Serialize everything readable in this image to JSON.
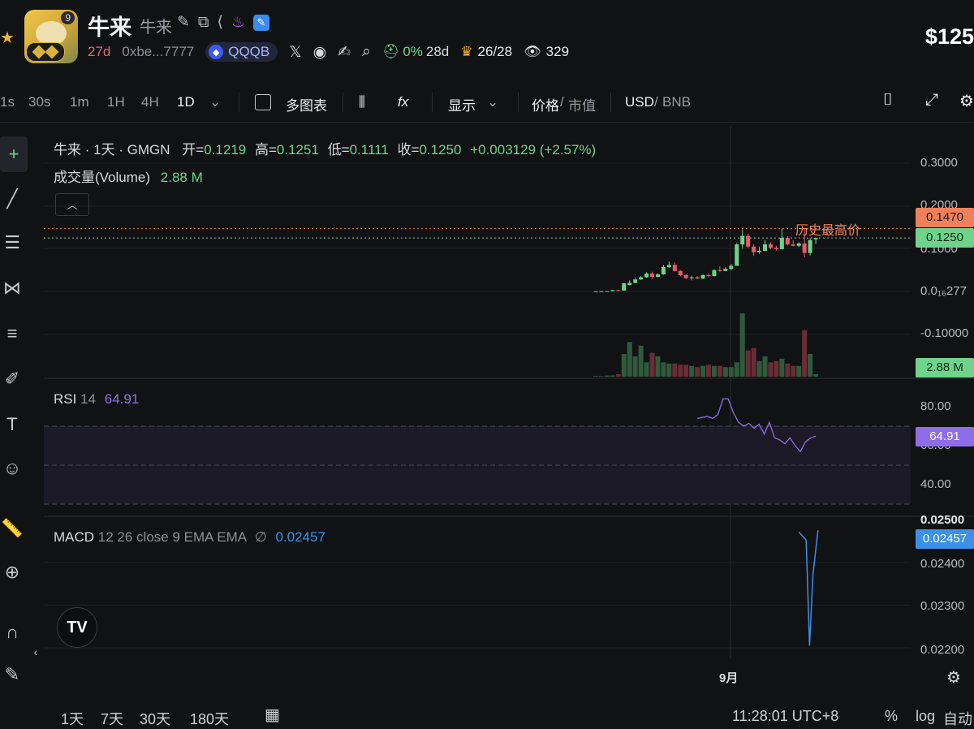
{
  "header": {
    "avatar_count": "9",
    "title": "牛来",
    "subtitle": "牛来",
    "age": "27d",
    "address": "0xbe...7777",
    "pill_label": "QQQB",
    "x_icon": "x-logo-icon",
    "stat_percent": "0%",
    "stat_days": "28d",
    "holders": "26/28",
    "views": "329",
    "price": "$125"
  },
  "toolbar": {
    "intervals": [
      "1s",
      "30s",
      "1m",
      "1H",
      "4H",
      "1D"
    ],
    "active_interval": "1D",
    "multi_chart": "多图表",
    "display": "显示",
    "price_label": "价格",
    "mcap_label": "市值",
    "usd_label": "USD",
    "bnb_label": "BNB"
  },
  "legend": {
    "symbol": "牛来 · 1天 · GMGN",
    "open_label": "开=",
    "open": "0.1219",
    "high_label": "高=",
    "high": "0.1251",
    "low_label": "低=",
    "low": "0.1111",
    "close_label": "收=",
    "close": "0.1250",
    "change": "+0.003129 (+2.57%)",
    "volume_label": "成交量(Volume)",
    "volume": "2.88 M"
  },
  "price_axis": {
    "labels": [
      "0.3000",
      "0.2000",
      "0.1000",
      "0.0₁₆277",
      "-0.10000"
    ],
    "ath_value": "0.1470",
    "ath_text": "历史最高价",
    "last_value": "0.1250",
    "volume_value": "2.88 M",
    "ath_color": "#f0805a",
    "up_color": "#6fd38b",
    "down_color": "#e85a6c"
  },
  "rsi": {
    "label": "RSI",
    "period": "14",
    "value": "64.91",
    "axis": [
      "80.00",
      "60.00",
      "40.00"
    ],
    "color": "#8f6de8",
    "series": [
      74,
      74.5,
      75,
      74,
      76,
      84,
      84,
      77,
      72,
      70,
      71.5,
      69,
      71,
      66,
      72,
      64,
      63,
      61,
      64,
      60,
      57,
      62,
      64,
      64.9
    ]
  },
  "macd": {
    "label": "MACD",
    "params": "12 26 close 9 EMA EMA",
    "null_symbol": "∅",
    "value": "0.02457",
    "axis": [
      "0.02500",
      "0.02400",
      "0.02300",
      "0.02200"
    ],
    "color": "#3a92e8",
    "series": [
      0.02471,
      0.02452,
      0.02205,
      0.02372,
      0.02475
    ]
  },
  "chart_data": {
    "type": "line",
    "candles_ohlc": [
      [
        0.0001,
        0.0002,
        0.0001,
        0.0002
      ],
      [
        0.0002,
        0.0003,
        0.0002,
        0.0003
      ],
      [
        0.0005,
        0.0006,
        0.0005,
        0.0006
      ],
      [
        0.0006,
        0.0035,
        0.0006,
        0.003
      ],
      [
        0.003,
        0.004,
        0.001,
        0.002
      ],
      [
        0.002,
        0.02,
        0.002,
        0.019
      ],
      [
        0.015,
        0.026,
        0.014,
        0.02
      ],
      [
        0.02,
        0.032,
        0.019,
        0.028
      ],
      [
        0.028,
        0.036,
        0.027,
        0.033
      ],
      [
        0.033,
        0.045,
        0.032,
        0.042
      ],
      [
        0.042,
        0.046,
        0.03,
        0.034
      ],
      [
        0.034,
        0.042,
        0.033,
        0.04
      ],
      [
        0.04,
        0.062,
        0.039,
        0.057
      ],
      [
        0.057,
        0.07,
        0.055,
        0.062
      ],
      [
        0.062,
        0.068,
        0.046,
        0.048
      ],
      [
        0.048,
        0.05,
        0.035,
        0.038
      ],
      [
        0.038,
        0.04,
        0.029,
        0.031
      ],
      [
        0.031,
        0.037,
        0.026,
        0.033
      ],
      [
        0.033,
        0.036,
        0.029,
        0.03
      ],
      [
        0.03,
        0.04,
        0.029,
        0.038
      ],
      [
        0.038,
        0.042,
        0.033,
        0.036
      ],
      [
        0.036,
        0.052,
        0.035,
        0.05
      ],
      [
        0.05,
        0.058,
        0.045,
        0.048
      ],
      [
        0.048,
        0.056,
        0.047,
        0.053
      ],
      [
        0.053,
        0.064,
        0.05,
        0.06
      ],
      [
        0.06,
        0.113,
        0.06,
        0.11
      ],
      [
        0.11,
        0.145,
        0.1,
        0.13
      ],
      [
        0.13,
        0.135,
        0.102,
        0.105
      ],
      [
        0.105,
        0.11,
        0.083,
        0.092
      ],
      [
        0.092,
        0.105,
        0.088,
        0.095
      ],
      [
        0.095,
        0.12,
        0.094,
        0.11
      ],
      [
        0.11,
        0.115,
        0.099,
        0.102
      ],
      [
        0.102,
        0.107,
        0.096,
        0.099
      ],
      [
        0.099,
        0.147,
        0.098,
        0.125
      ],
      [
        0.125,
        0.13,
        0.108,
        0.11
      ],
      [
        0.11,
        0.12,
        0.105,
        0.107
      ],
      [
        0.107,
        0.115,
        0.104,
        0.112
      ],
      [
        0.112,
        0.147,
        0.08,
        0.09
      ],
      [
        0.09,
        0.125,
        0.084,
        0.12
      ],
      [
        0.1219,
        0.1251,
        0.1111,
        0.125
      ]
    ],
    "volume_values": [
      0.05,
      0.05,
      0.1,
      0.1,
      0.2,
      1.9,
      2.9,
      1.7,
      2.6,
      1.2,
      2.0,
      1.7,
      1.2,
      1.1,
      1.1,
      1.0,
      1.0,
      0.9,
      0.8,
      0.9,
      1.0,
      0.9,
      0.9,
      0.8,
      0.8,
      1.2,
      5.3,
      2.2,
      2.4,
      1.3,
      1.7,
      1.2,
      1.3,
      1.5,
      1.1,
      0.9,
      0.9,
      3.9,
      1.9,
      0.2
    ],
    "x_label": "9月"
  },
  "bottom": {
    "ranges": [
      "1天",
      "7天",
      "30天",
      "180天"
    ],
    "time": "11:28:01 UTC+8",
    "percent": "%",
    "log": "log",
    "auto": "自动"
  }
}
